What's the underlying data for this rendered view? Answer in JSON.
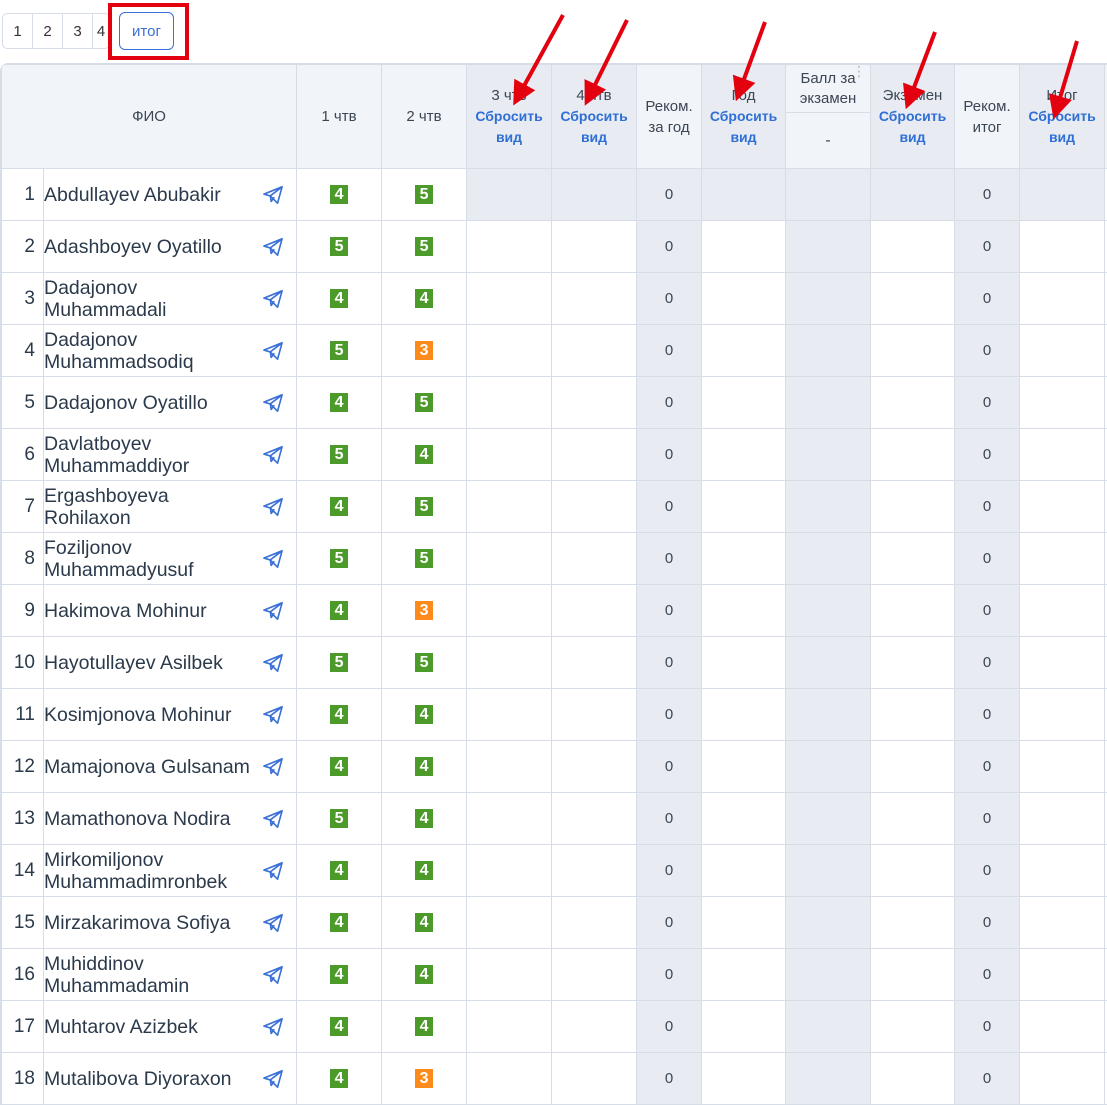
{
  "tabs": [
    "1",
    "2",
    "3",
    "4"
  ],
  "tab_itog": "итог",
  "header": {
    "fio": "ФИО",
    "q1": "1 чтв",
    "q2": "2 чтв",
    "q3": "3 чтв",
    "q4": "4 чтв",
    "rekom_god": "Реком. за год",
    "god": "Год",
    "ball_exam": "Балл за экзамен",
    "ball_exam_value": "-",
    "exam": "Экзамен",
    "rekom_itog": "Реком. итог",
    "itog": "Итог",
    "reset": "Сбросить вид"
  },
  "students": [
    {
      "n": "1",
      "name": "Abdullayev Abubakir",
      "q1": "4",
      "q2": "5",
      "rekom_god": "0",
      "rekom_itog": "0"
    },
    {
      "n": "2",
      "name": "Adashboyev Oyatillo",
      "q1": "5",
      "q2": "5",
      "rekom_god": "0",
      "rekom_itog": "0"
    },
    {
      "n": "3",
      "name": "Dadajonov Muhammadali",
      "q1": "4",
      "q2": "4",
      "rekom_god": "0",
      "rekom_itog": "0"
    },
    {
      "n": "4",
      "name": "Dadajonov Muhammadsodiq",
      "q1": "5",
      "q2": "3",
      "rekom_god": "0",
      "rekom_itog": "0"
    },
    {
      "n": "5",
      "name": "Dadajonov Oyatillo",
      "q1": "4",
      "q2": "5",
      "rekom_god": "0",
      "rekom_itog": "0"
    },
    {
      "n": "6",
      "name": "Davlatboyev Muhammaddiyor",
      "q1": "5",
      "q2": "4",
      "rekom_god": "0",
      "rekom_itog": "0"
    },
    {
      "n": "7",
      "name": "Ergashboyeva Rohilaxon",
      "q1": "4",
      "q2": "5",
      "rekom_god": "0",
      "rekom_itog": "0"
    },
    {
      "n": "8",
      "name": "Foziljonov Muhammadyusuf",
      "q1": "5",
      "q2": "5",
      "rekom_god": "0",
      "rekom_itog": "0"
    },
    {
      "n": "9",
      "name": "Hakimova Mohinur",
      "q1": "4",
      "q2": "3",
      "rekom_god": "0",
      "rekom_itog": "0"
    },
    {
      "n": "10",
      "name": "Hayotullayev Asilbek",
      "q1": "5",
      "q2": "5",
      "rekom_god": "0",
      "rekom_itog": "0"
    },
    {
      "n": "11",
      "name": "Kosimjonova Mohinur",
      "q1": "4",
      "q2": "4",
      "rekom_god": "0",
      "rekom_itog": "0"
    },
    {
      "n": "12",
      "name": "Mamajonova Gulsanam",
      "q1": "4",
      "q2": "4",
      "rekom_god": "0",
      "rekom_itog": "0"
    },
    {
      "n": "13",
      "name": "Mamathonova Nodira",
      "q1": "5",
      "q2": "4",
      "rekom_god": "0",
      "rekom_itog": "0"
    },
    {
      "n": "14",
      "name": "Mirkomiljonov Muhammadimronbek",
      "q1": "4",
      "q2": "4",
      "rekom_god": "0",
      "rekom_itog": "0"
    },
    {
      "n": "15",
      "name": "Mirzakarimova Sofiya",
      "q1": "4",
      "q2": "4",
      "rekom_god": "0",
      "rekom_itog": "0"
    },
    {
      "n": "16",
      "name": "Muhiddinov Muhammadamin",
      "q1": "4",
      "q2": "4",
      "rekom_god": "0",
      "rekom_itog": "0"
    },
    {
      "n": "17",
      "name": "Muhtarov Azizbek",
      "q1": "4",
      "q2": "4",
      "rekom_god": "0",
      "rekom_itog": "0"
    },
    {
      "n": "18",
      "name": "Mutalibova Diyoraxon",
      "q1": "4",
      "q2": "3",
      "rekom_god": "0",
      "rekom_itog": "0"
    }
  ],
  "colors": {
    "grade5": "#4c9a2a",
    "grade4": "#4c9a2a",
    "grade3": "#ff8a1c",
    "link": "#2f6fd6",
    "annotation_red": "#e3000f"
  },
  "icons": {
    "row_action": "paper-plane-icon",
    "column_menu": "kebab-icon",
    "annotation": "red-arrow-icon"
  }
}
